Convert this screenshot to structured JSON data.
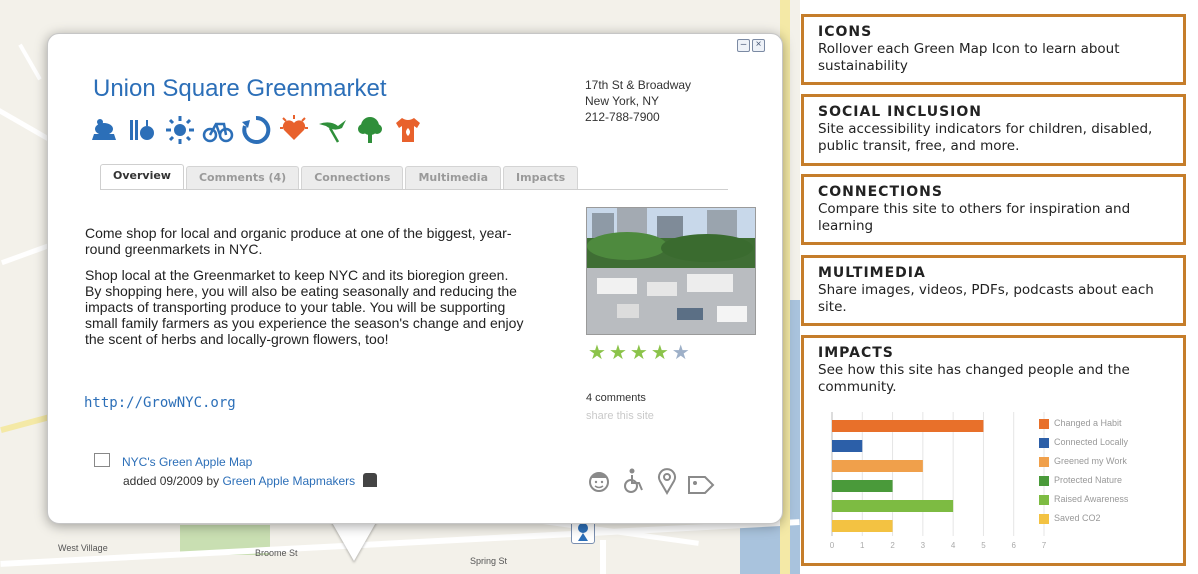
{
  "map": {
    "labels": [
      "West Village",
      "Broome St",
      "Spring St"
    ]
  },
  "popup": {
    "title": "Union Square Greenmarket",
    "minimize_symbol": "–",
    "close_symbol": "×",
    "address": [
      "17th St & Broadway",
      "New York, NY",
      "212-788-7900"
    ],
    "icons": [
      "farmers-market",
      "local-food",
      "sun-energy",
      "bike",
      "recycling",
      "health",
      "bird-habitat",
      "tree",
      "eco-fashion"
    ],
    "tabs": [
      {
        "label": "Overview",
        "active": true
      },
      {
        "label": "Comments (4)",
        "active": false
      },
      {
        "label": "Connections",
        "active": false
      },
      {
        "label": "Multimedia",
        "active": false
      },
      {
        "label": "Impacts",
        "active": false
      }
    ],
    "description": [
      "Come shop for local and organic produce at one of the biggest, year-round greenmarkets in NYC.",
      "Shop local at the Greenmarket to keep NYC and its bioregion green. By shopping here, you will also be eating seasonally and reducing the impacts of transporting produce to your table. You will be supporting small family farmers as you experience the season's change and enjoy the scent of herbs and locally-grown flowers, too!"
    ],
    "link": "http://GrowNYC.org",
    "rating": {
      "value": 4,
      "max": 5
    },
    "comments_count": "4 comments",
    "share_label": "share this site",
    "map_name": "NYC's Green Apple Map",
    "added_prefix": "added 09/2009 by",
    "added_by": "Green Apple Mapmakers",
    "accessibility_icons": [
      "child-friendly",
      "wheelchair-accessible",
      "location",
      "free"
    ]
  },
  "info_panel": [
    {
      "title": "ICONS",
      "text": "Rollover each Green Map Icon to learn about sustainability"
    },
    {
      "title": "SOCIAL INCLUSION",
      "text": "Site accessibility indicators for children, disabled, public transit, free, and more."
    },
    {
      "title": "CONNECTIONS",
      "text": "Compare this site to others for inspiration and learning"
    },
    {
      "title": "MULTIMEDIA",
      "text": "Share images, videos, PDFs, podcasts about each site."
    },
    {
      "title": "IMPACTS",
      "text": "See how this site has changed people and the community."
    }
  ],
  "colors": {
    "accent_orange": "#c57d2a",
    "title_blue": "#2c6fb8",
    "icon_blue": "#2c6fb8",
    "icon_orange": "#e8612c",
    "icon_green": "#2f8f3a"
  },
  "chart_data": {
    "type": "bar",
    "orientation": "horizontal",
    "categories": [
      "Changed a Habit",
      "Connected Locally",
      "Greened my Work",
      "Protected Nature",
      "Raised Awareness",
      "Saved CO2"
    ],
    "values": [
      5,
      1,
      3,
      2,
      4,
      2
    ],
    "colors": [
      "#e8702a",
      "#2c5fa8",
      "#f0a04b",
      "#4a9a3a",
      "#7dbb42",
      "#f3c242"
    ],
    "xlim": [
      0,
      7
    ],
    "x_ticks": [
      "0",
      "1",
      "2",
      "3",
      "4",
      "5",
      "6",
      "7"
    ],
    "legend": "right"
  }
}
